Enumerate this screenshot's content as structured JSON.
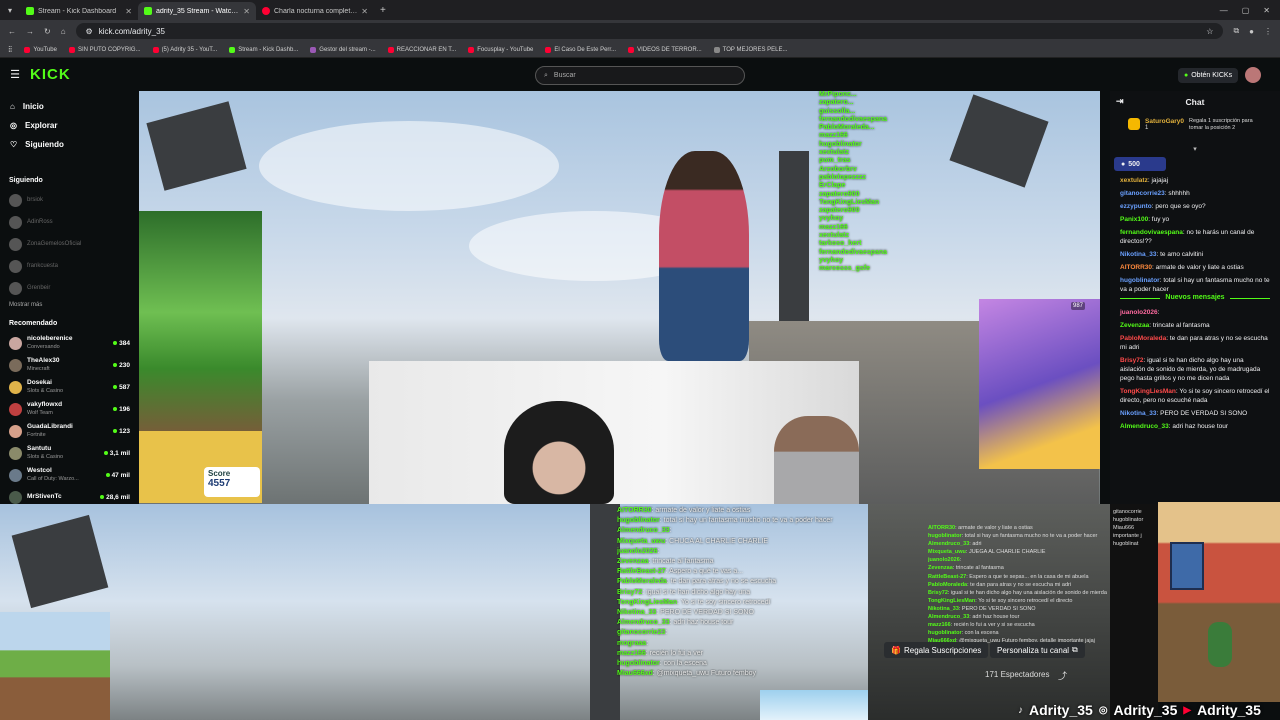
{
  "browser": {
    "tabs": [
      {
        "label": "Stream - Kick Dashboard",
        "color": "#53fc18"
      },
      {
        "label": "adrity_35 Stream - Watch L...",
        "color": "#53fc18",
        "active": true
      },
      {
        "label": "Charla nocturna completamen...",
        "color": "#ff0033"
      }
    ],
    "url": "kick.com/adrity_35",
    "bookmarks": [
      "YouTube",
      "SIN PUTO COPYRIG...",
      "(5) Adrity 35 - YouT...",
      "Stream - Kick Dashb...",
      "Gestor del stream -...",
      "REACCIONAR EN T...",
      "Focusplay - YouTube",
      "El Caso De Este Perr...",
      "VIDEOS DE TERROR...",
      "TOP MEJORES PELE..."
    ]
  },
  "header": {
    "logo": "KICK",
    "search_placeholder": "Buscar",
    "get_kicks": "Obtén KICKs"
  },
  "sidebar": {
    "nav": [
      {
        "label": "Inicio",
        "icon": "home-icon"
      },
      {
        "label": "Explorar",
        "icon": "compass-icon"
      },
      {
        "label": "Siguiendo",
        "icon": "heart-icon"
      }
    ],
    "following_title": "Siguiendo",
    "following": [
      "brsiok",
      "AdinRoss",
      "ZonaGemelosOficial",
      "frankcuesta",
      "Grenbeir"
    ],
    "show_more": "Mostrar más",
    "recommended_title": "Recomendado",
    "recommended": [
      {
        "name": "nicoleberenice",
        "cat": "Conversando",
        "viewers": "384",
        "color": "#c9a6a0"
      },
      {
        "name": "TheAlex30",
        "cat": "Minecraft",
        "viewers": "230",
        "color": "#7a6b5b"
      },
      {
        "name": "Dosekai",
        "cat": "Slots & Casino",
        "viewers": "587",
        "color": "#e0b34a"
      },
      {
        "name": "vakyflowxd",
        "cat": "Wolf Team",
        "viewers": "196",
        "color": "#c04040"
      },
      {
        "name": "GuadaLibrandi",
        "cat": "Fortnite",
        "viewers": "123",
        "color": "#d6a08a"
      },
      {
        "name": "Santutu",
        "cat": "Slots & Casino",
        "viewers": "3,1 mil",
        "color": "#8a8a6a"
      },
      {
        "name": "Westcol",
        "cat": "Call of Duty: Warzo...",
        "viewers": "47 mil",
        "color": "#6a7a8a"
      },
      {
        "name": "MrStivenTc",
        "cat": "",
        "viewers": "28,6 mil",
        "color": "#4a5a4a"
      }
    ]
  },
  "video": {
    "score_label": "Score",
    "score_value": "4557",
    "cube_badge": "987",
    "overlay_chat": [
      "MrPiponc...",
      "zapatero...",
      "guissolla...",
      "fernandodivaespana",
      "PabloMoraleda...",
      "mazz166",
      "hugoblinator",
      "xextulatz",
      "pum_tras",
      "Arzoborbrv",
      "pablolopezzzz",
      "ErClape",
      "zapatero900",
      "TongKingLiesMan",
      "zapatero900",
      "yvyhoy",
      "mazz166",
      "xextulatz",
      "tarkoso_hert",
      "fernandodivaespana",
      "yvyhoy",
      "marcosss_gsfe"
    ]
  },
  "bottom_overlay": [
    {
      "user": "AITORR30",
      "text": ": armate de valor y liate a ostias"
    },
    {
      "user": "hugoblinator",
      "text": ": total si hay un fantasma mucho no te va a poder hacer"
    },
    {
      "user": "Almendruco_33",
      "text": ": "
    },
    {
      "user": "Mixqueta_uwu",
      "text": ": CHUCA AL CHARLIE CHARLIE"
    },
    {
      "user": "juanolo2026",
      "text": ": "
    },
    {
      "user": "Zevenzaa",
      "text": ": trincate al fantasma"
    },
    {
      "user": "RattleBeast-27",
      "text": ": Aspero a qué te vas a..."
    },
    {
      "user": "PabloMoraleda",
      "text": ": te dan para atras y no se escucha"
    },
    {
      "user": "Brisy72",
      "text": ": igual si te han dicho algo hay una"
    },
    {
      "user": "TongKingLiesMan",
      "text": ": Yo si te soy sincero retrocedí"
    },
    {
      "user": "Nikotina_33",
      "text": ": PERO DE VERDAD SI SONO"
    },
    {
      "user": "Almendruco_33",
      "text": ": adri haz house tour"
    },
    {
      "user": "gitanocorrie23",
      "text": ": "
    },
    {
      "user": "mograaa",
      "text": ": "
    },
    {
      "user": "mazz166",
      "text": ": recién lo fui a ver"
    },
    {
      "user": "hugoblinator",
      "text": ": con la escena"
    },
    {
      "user": "Miau666xd",
      "text": ": @mixqueta_uwu Futuro femboy"
    }
  ],
  "mini_chat": [
    {
      "user": "AITORR30",
      "text": ": armate de valor y liate a ostias"
    },
    {
      "user": "hugoblinator",
      "text": ": total si hay un fantasma mucho no te va a poder hacer"
    },
    {
      "user": "Almendruco_33",
      "text": ": adri"
    },
    {
      "user": "Mixqueta_uwu",
      "text": ": JUEGA AL CHARLIE CHARLIE"
    },
    {
      "user": "juanolo2026",
      "text": ": "
    },
    {
      "user": "Zevenzaa",
      "text": ": trincate al fantasma"
    },
    {
      "user": "RattleBeast-27",
      "text": ": Espero a que te sepas... en la casa de mi abuela"
    },
    {
      "user": "PabloMoraleda",
      "text": ": te dan para atras y no se escucha mi adri"
    },
    {
      "user": "Brisy72",
      "text": ": igual si te han dicho algo hay una aislación de sonido de mierda"
    },
    {
      "user": "TongKingLiesMan",
      "text": ": Yo si te soy sincero retrocedí el directo"
    },
    {
      "user": "Nikotina_33",
      "text": ": PERO DE VERDAD SI SONO"
    },
    {
      "user": "Almendruco_33",
      "text": ": adri haz house tour"
    },
    {
      "user": "mazz166",
      "text": ": recién lo fui a ver y si se escucha"
    },
    {
      "user": "hugoblinator",
      "text": ": con la escena"
    },
    {
      "user": "Miau666xd",
      "text": ": @mixqueta_uwu Futuro femboy, detalle importante jajaj"
    }
  ],
  "stream_bar": {
    "gift_sub": "Regala Suscripciones",
    "customize": "Personaliza tu canal",
    "viewers": "171 Espectadores",
    "count": "0"
  },
  "chat": {
    "title": "Chat",
    "pinned_user": "SaturoGary0",
    "pinned_text": "Regala 1 suscripción para tomar la posición 2",
    "pinned_num": "1",
    "tip": "500",
    "new_messages": "Nuevos mensajes",
    "messages": [
      {
        "user": "xextulatz",
        "text": ": jajajaj",
        "color": "#e2b13c"
      },
      {
        "user": "gitanocorrie23",
        "text": ": shhhhh",
        "color": "#6aa0ff"
      },
      {
        "user": "ezzypunto",
        "text": ": pero que se oyo?",
        "color": "#6aa0ff"
      },
      {
        "user": "Panix100",
        "text": ": fuy yo",
        "color": "#53fc18"
      },
      {
        "user": "fernandovivaespana",
        "text": ": no te harás un canal de directos!??",
        "color": "#53fc18"
      },
      {
        "user": "Nikotina_33",
        "text": ": te amo calvitini",
        "color": "#6aa0ff"
      },
      {
        "user": "AITORR30",
        "text": ": armate de valor y liate a ostias",
        "color": "#ff8a3d"
      },
      {
        "user": "hugoblinator",
        "text": ": total si hay un fantasma mucho no te va a poder hacer",
        "color": "#6aa0ff"
      }
    ],
    "messages2": [
      {
        "user": "juanolo2026",
        "text": ": ",
        "color": "#ff6aa0"
      },
      {
        "user": "Zevenzaa",
        "text": ": trincate al fantasma",
        "color": "#53fc18"
      },
      {
        "user": "PabloMoraleda",
        "text": ": te dan para atras y no se escucha mi adri",
        "color": "#ff4a4a"
      },
      {
        "user": "Brisy72",
        "text": ": igual si te han dicho algo hay una aislación de sonido de mierda, yo de madrugada pego hasta grillos y no me dicen nada",
        "color": "#ff4a4a"
      },
      {
        "user": "TongKingLiesMan",
        "text": ": Yo si te soy sincero retrocedí el directo, pero no escuché nada",
        "color": "#ff4a4a"
      },
      {
        "user": "Nikotina_33",
        "text": ": PERO DE VERDAD SI SONO",
        "color": "#6aa0ff"
      },
      {
        "user": "Almendruco_33",
        "text": ": adri haz house tour",
        "color": "#53fc18"
      }
    ]
  },
  "bottom_chat": [
    "gitanocorrie",
    "",
    "hugoblinator",
    "Miau666",
    "importante j",
    "hugoblinat"
  ],
  "socials": [
    "Adrity_35",
    "Adrity_35",
    "Adrity_35"
  ]
}
